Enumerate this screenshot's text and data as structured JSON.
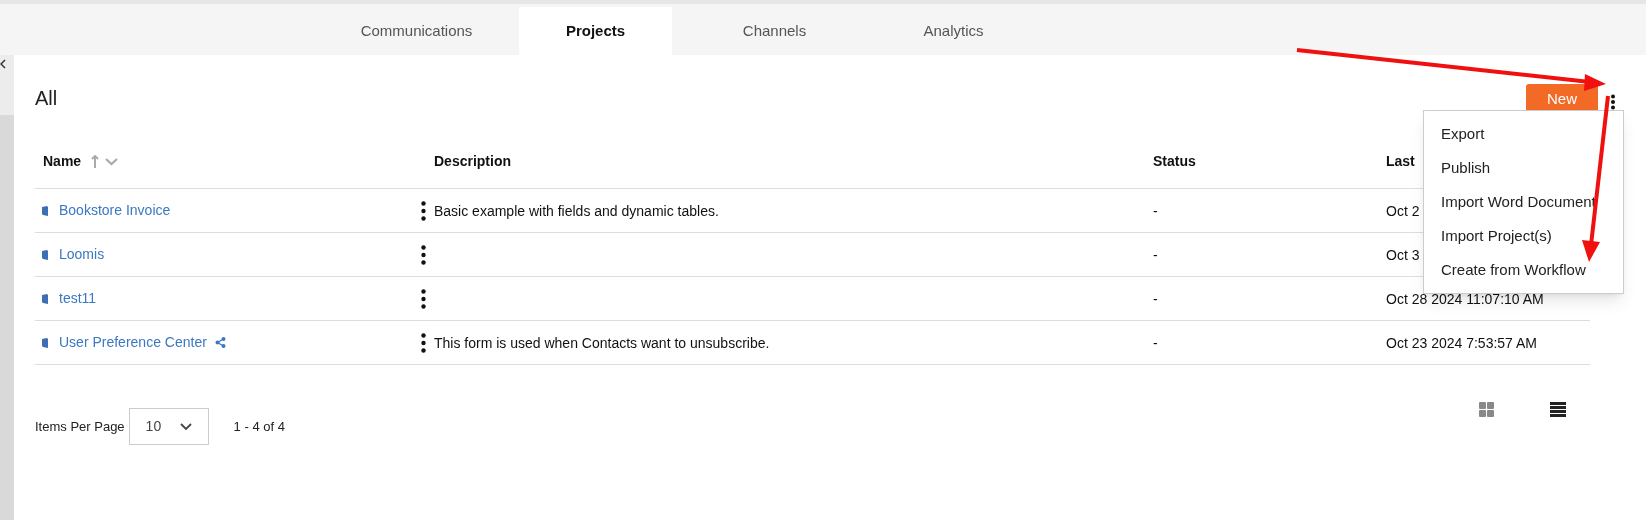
{
  "tabs": [
    {
      "label": "Communications",
      "selected": false
    },
    {
      "label": "Projects",
      "selected": true
    },
    {
      "label": "Channels",
      "selected": false
    },
    {
      "label": "Analytics",
      "selected": false
    }
  ],
  "title": "All",
  "new_button": "New",
  "menu": [
    "Export",
    "Publish",
    "Import Word Document",
    "Import Project(s)",
    "Create from Workflow"
  ],
  "table": {
    "columns": [
      "Name",
      "Description",
      "Status",
      "Last"
    ],
    "rows": [
      {
        "name": "Bookstore Invoice",
        "shared": false,
        "description": "Basic example with fields and dynamic tables.",
        "status": "-",
        "last_modified": "Oct 2"
      },
      {
        "name": "Loomis",
        "shared": false,
        "description": "",
        "status": "-",
        "last_modified": "Oct 3"
      },
      {
        "name": "test11",
        "shared": false,
        "description": "",
        "status": "-",
        "last_modified": "Oct 28 2024 11:07:10 AM"
      },
      {
        "name": "User Preference Center",
        "shared": true,
        "description": "This form is used when Contacts want to unsubscribe.",
        "status": "-",
        "last_modified": "Oct 23 2024 7:53:57 AM"
      }
    ]
  },
  "pagination": {
    "label": "Items Per Page",
    "page_size": "10",
    "range": "1 - 4 of 4"
  },
  "views": [
    {
      "kind": "grid",
      "selected": false
    },
    {
      "kind": "list",
      "selected": true
    }
  ]
}
